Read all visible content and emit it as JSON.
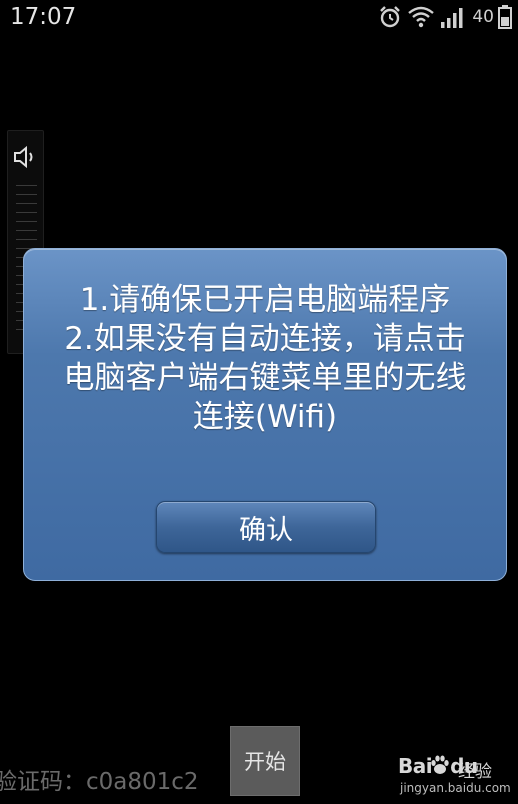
{
  "status_bar": {
    "time": "17:07",
    "battery_label": "40",
    "icons": [
      "alarm-icon",
      "wifi-icon",
      "signal-icon",
      "battery-icon"
    ]
  },
  "volume": {
    "icon": "speaker-icon"
  },
  "dialog": {
    "message_lines": [
      "1.请确保已开启电脑端程序",
      "2.如果没有自动连接，请点击",
      "电脑客户端右键菜单里的无线",
      "连接(Wifi)"
    ],
    "confirm_label": "确认"
  },
  "bottom": {
    "verify_text": "验证码：c0a801c2",
    "start_label": "开始"
  },
  "watermark": {
    "logo": "Bai",
    "logo_suffix": "du",
    "product": "经验",
    "domain": "jingyan.baidu.com"
  },
  "colors": {
    "background": "#000000",
    "dialog_top": "#6b94c7",
    "dialog_bottom": "#3f6aa2",
    "button_gray": "#5b5b5b"
  }
}
